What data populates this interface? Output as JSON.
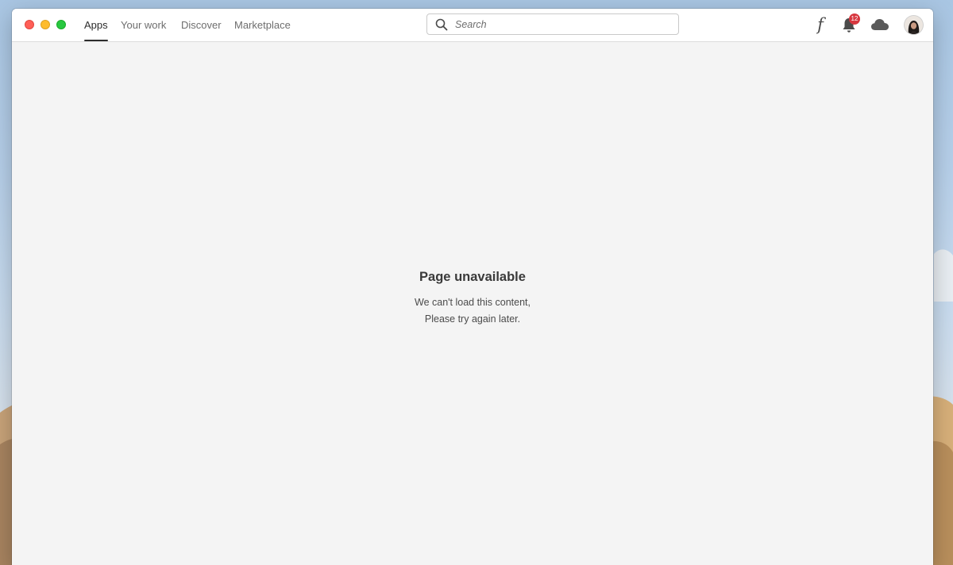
{
  "nav": {
    "tabs": [
      {
        "label": "Apps",
        "active": true
      },
      {
        "label": "Your work",
        "active": false
      },
      {
        "label": "Discover",
        "active": false
      },
      {
        "label": "Marketplace",
        "active": false
      }
    ]
  },
  "search": {
    "placeholder": "Search",
    "value": ""
  },
  "toolbar": {
    "fonts_icon": "f",
    "notifications_count": "12",
    "notifications_badge_color": "#d7373f",
    "cloud_icon": "cloud-icon"
  },
  "main": {
    "error_title": "Page unavailable",
    "error_line1": "We can't load this content,",
    "error_line2": "Please try again later."
  }
}
